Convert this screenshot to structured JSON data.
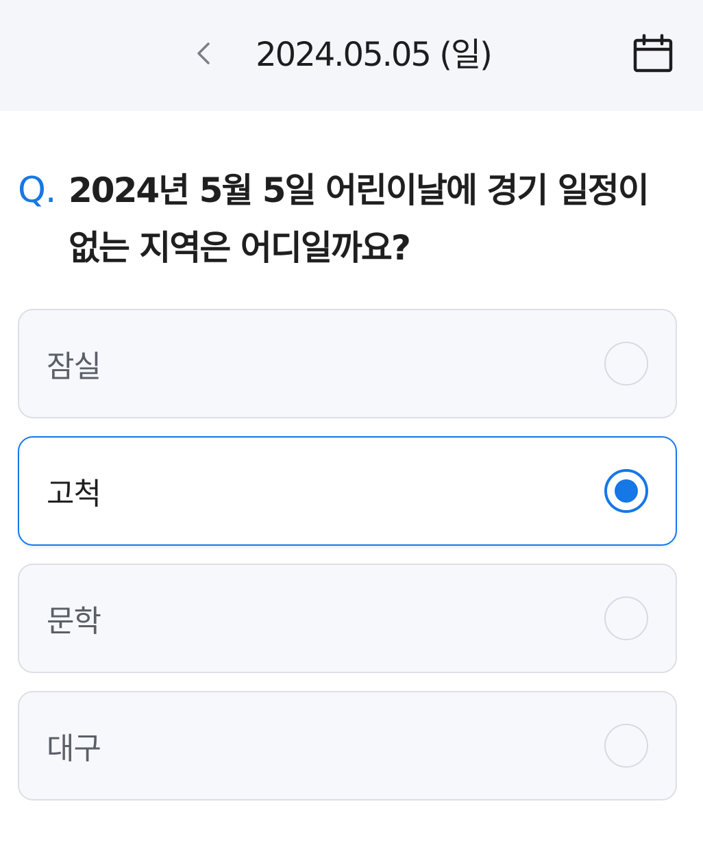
{
  "header": {
    "back_icon": "chevron-left-icon",
    "date": "2024.05.05 (일)",
    "calendar_icon": "calendar-icon"
  },
  "question": {
    "prefix": "Q.",
    "text": "2024년 5월 5일 어린이날에 경기 일정이 없는 지역은 어디일까요?"
  },
  "options": [
    {
      "label": "잠실",
      "selected": false
    },
    {
      "label": "고척",
      "selected": true
    },
    {
      "label": "문학",
      "selected": false
    },
    {
      "label": "대구",
      "selected": false
    }
  ],
  "colors": {
    "accent": "#1677e6",
    "header_bg": "#f4f6fa",
    "option_bg": "#f6f8fc",
    "option_border": "#dcdfe5"
  }
}
